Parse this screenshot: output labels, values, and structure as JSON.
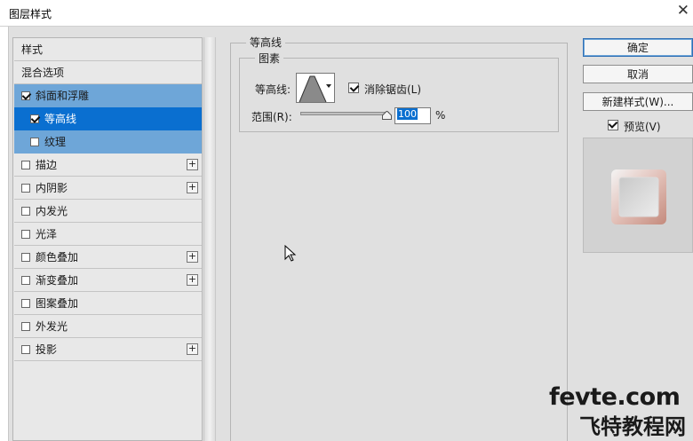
{
  "window": {
    "title": "图层样式",
    "close_glyph": "✕"
  },
  "styles_list": {
    "items": [
      {
        "label": "样式",
        "checkbox": false,
        "checked": false,
        "plus": false,
        "state": "normal",
        "indent": false
      },
      {
        "label": "混合选项",
        "checkbox": false,
        "checked": false,
        "plus": false,
        "state": "normal",
        "indent": false
      },
      {
        "label": "斜面和浮雕",
        "checkbox": true,
        "checked": true,
        "plus": false,
        "state": "selected",
        "indent": false
      },
      {
        "label": "等高线",
        "checkbox": true,
        "checked": true,
        "plus": false,
        "state": "active",
        "indent": true
      },
      {
        "label": "纹理",
        "checkbox": true,
        "checked": false,
        "plus": false,
        "state": "selected",
        "indent": true
      },
      {
        "label": "描边",
        "checkbox": true,
        "checked": false,
        "plus": true,
        "state": "normal",
        "indent": false
      },
      {
        "label": "内阴影",
        "checkbox": true,
        "checked": false,
        "plus": true,
        "state": "normal",
        "indent": false
      },
      {
        "label": "内发光",
        "checkbox": true,
        "checked": false,
        "plus": false,
        "state": "normal",
        "indent": false
      },
      {
        "label": "光泽",
        "checkbox": true,
        "checked": false,
        "plus": false,
        "state": "normal",
        "indent": false
      },
      {
        "label": "颜色叠加",
        "checkbox": true,
        "checked": false,
        "plus": true,
        "state": "normal",
        "indent": false
      },
      {
        "label": "渐变叠加",
        "checkbox": true,
        "checked": false,
        "plus": true,
        "state": "normal",
        "indent": false
      },
      {
        "label": "图案叠加",
        "checkbox": true,
        "checked": false,
        "plus": false,
        "state": "normal",
        "indent": false
      },
      {
        "label": "外发光",
        "checkbox": true,
        "checked": false,
        "plus": false,
        "state": "normal",
        "indent": false
      },
      {
        "label": "投影",
        "checkbox": true,
        "checked": false,
        "plus": true,
        "state": "normal",
        "indent": false
      }
    ],
    "plus_glyph": "+"
  },
  "contour_panel": {
    "section_title": "等高线",
    "group_title": "图素",
    "contour_label": "等高线:",
    "anti_alias_label": "消除锯齿(L)",
    "anti_alias_checked": true,
    "range_label": "范围(R):",
    "range_value": "100",
    "range_fraction": 1.0,
    "range_unit": "%"
  },
  "buttons": {
    "ok": "确定",
    "cancel": "取消",
    "new_style": "新建样式(W)...",
    "preview_label": "预览(V)",
    "preview_checked": true
  },
  "watermark": {
    "line1": "fevte.com",
    "line2": "飞特教程网"
  },
  "colors": {
    "selected_row": "#6ea6d8",
    "active_row": "#0a6fd0",
    "preview_swatch": "#d8a49a"
  }
}
